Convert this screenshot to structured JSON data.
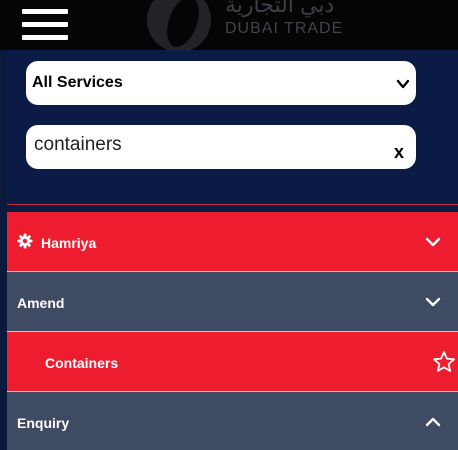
{
  "header": {
    "menu_icon": "hamburger-icon",
    "logo_arabic": "دبي التجارية",
    "logo_text": "DUBAI TRADE"
  },
  "filters": {
    "service_select": {
      "value": "All Services",
      "icon": "chevron-down-icon"
    },
    "search": {
      "value": "containers",
      "clear_label": "x"
    }
  },
  "colors": {
    "accent_red": "#ed1c2e",
    "slate": "#3f4b63",
    "navy": "#0b1b45"
  },
  "menu": {
    "items": [
      {
        "label": "Hamriya",
        "icon": "gear-icon",
        "toggle": "chevron-down-icon"
      },
      {
        "label": "Amend",
        "toggle": "chevron-down-icon"
      },
      {
        "label": "Containers",
        "icon": "star-outline-icon"
      },
      {
        "label": "Enquiry",
        "toggle": "chevron-up-icon"
      }
    ]
  }
}
